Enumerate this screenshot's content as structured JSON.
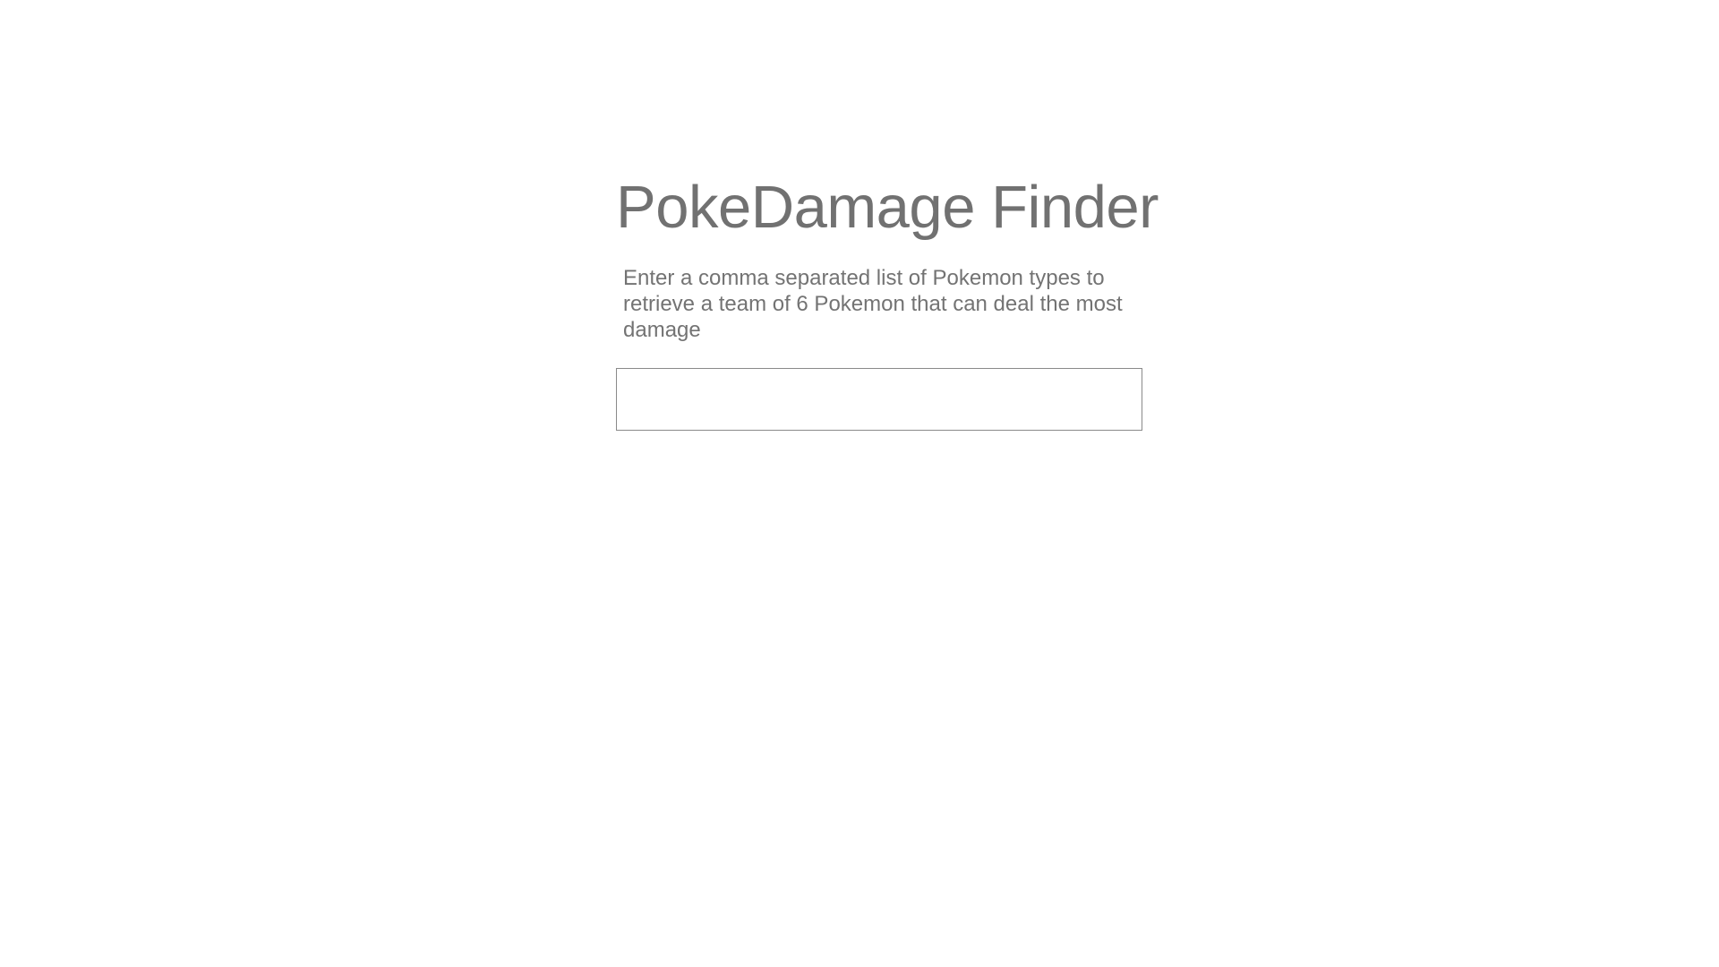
{
  "page": {
    "title": "PokeDamage Finder",
    "instructions": "Enter a comma separated list of Pokemon types to retrieve a team of 6 Pokemon that can deal the most damage"
  },
  "type_input": {
    "value": "",
    "placeholder": ""
  },
  "colors": {
    "background": "#ffffff",
    "text": "#757575",
    "input_border": "#8a8a8a"
  }
}
